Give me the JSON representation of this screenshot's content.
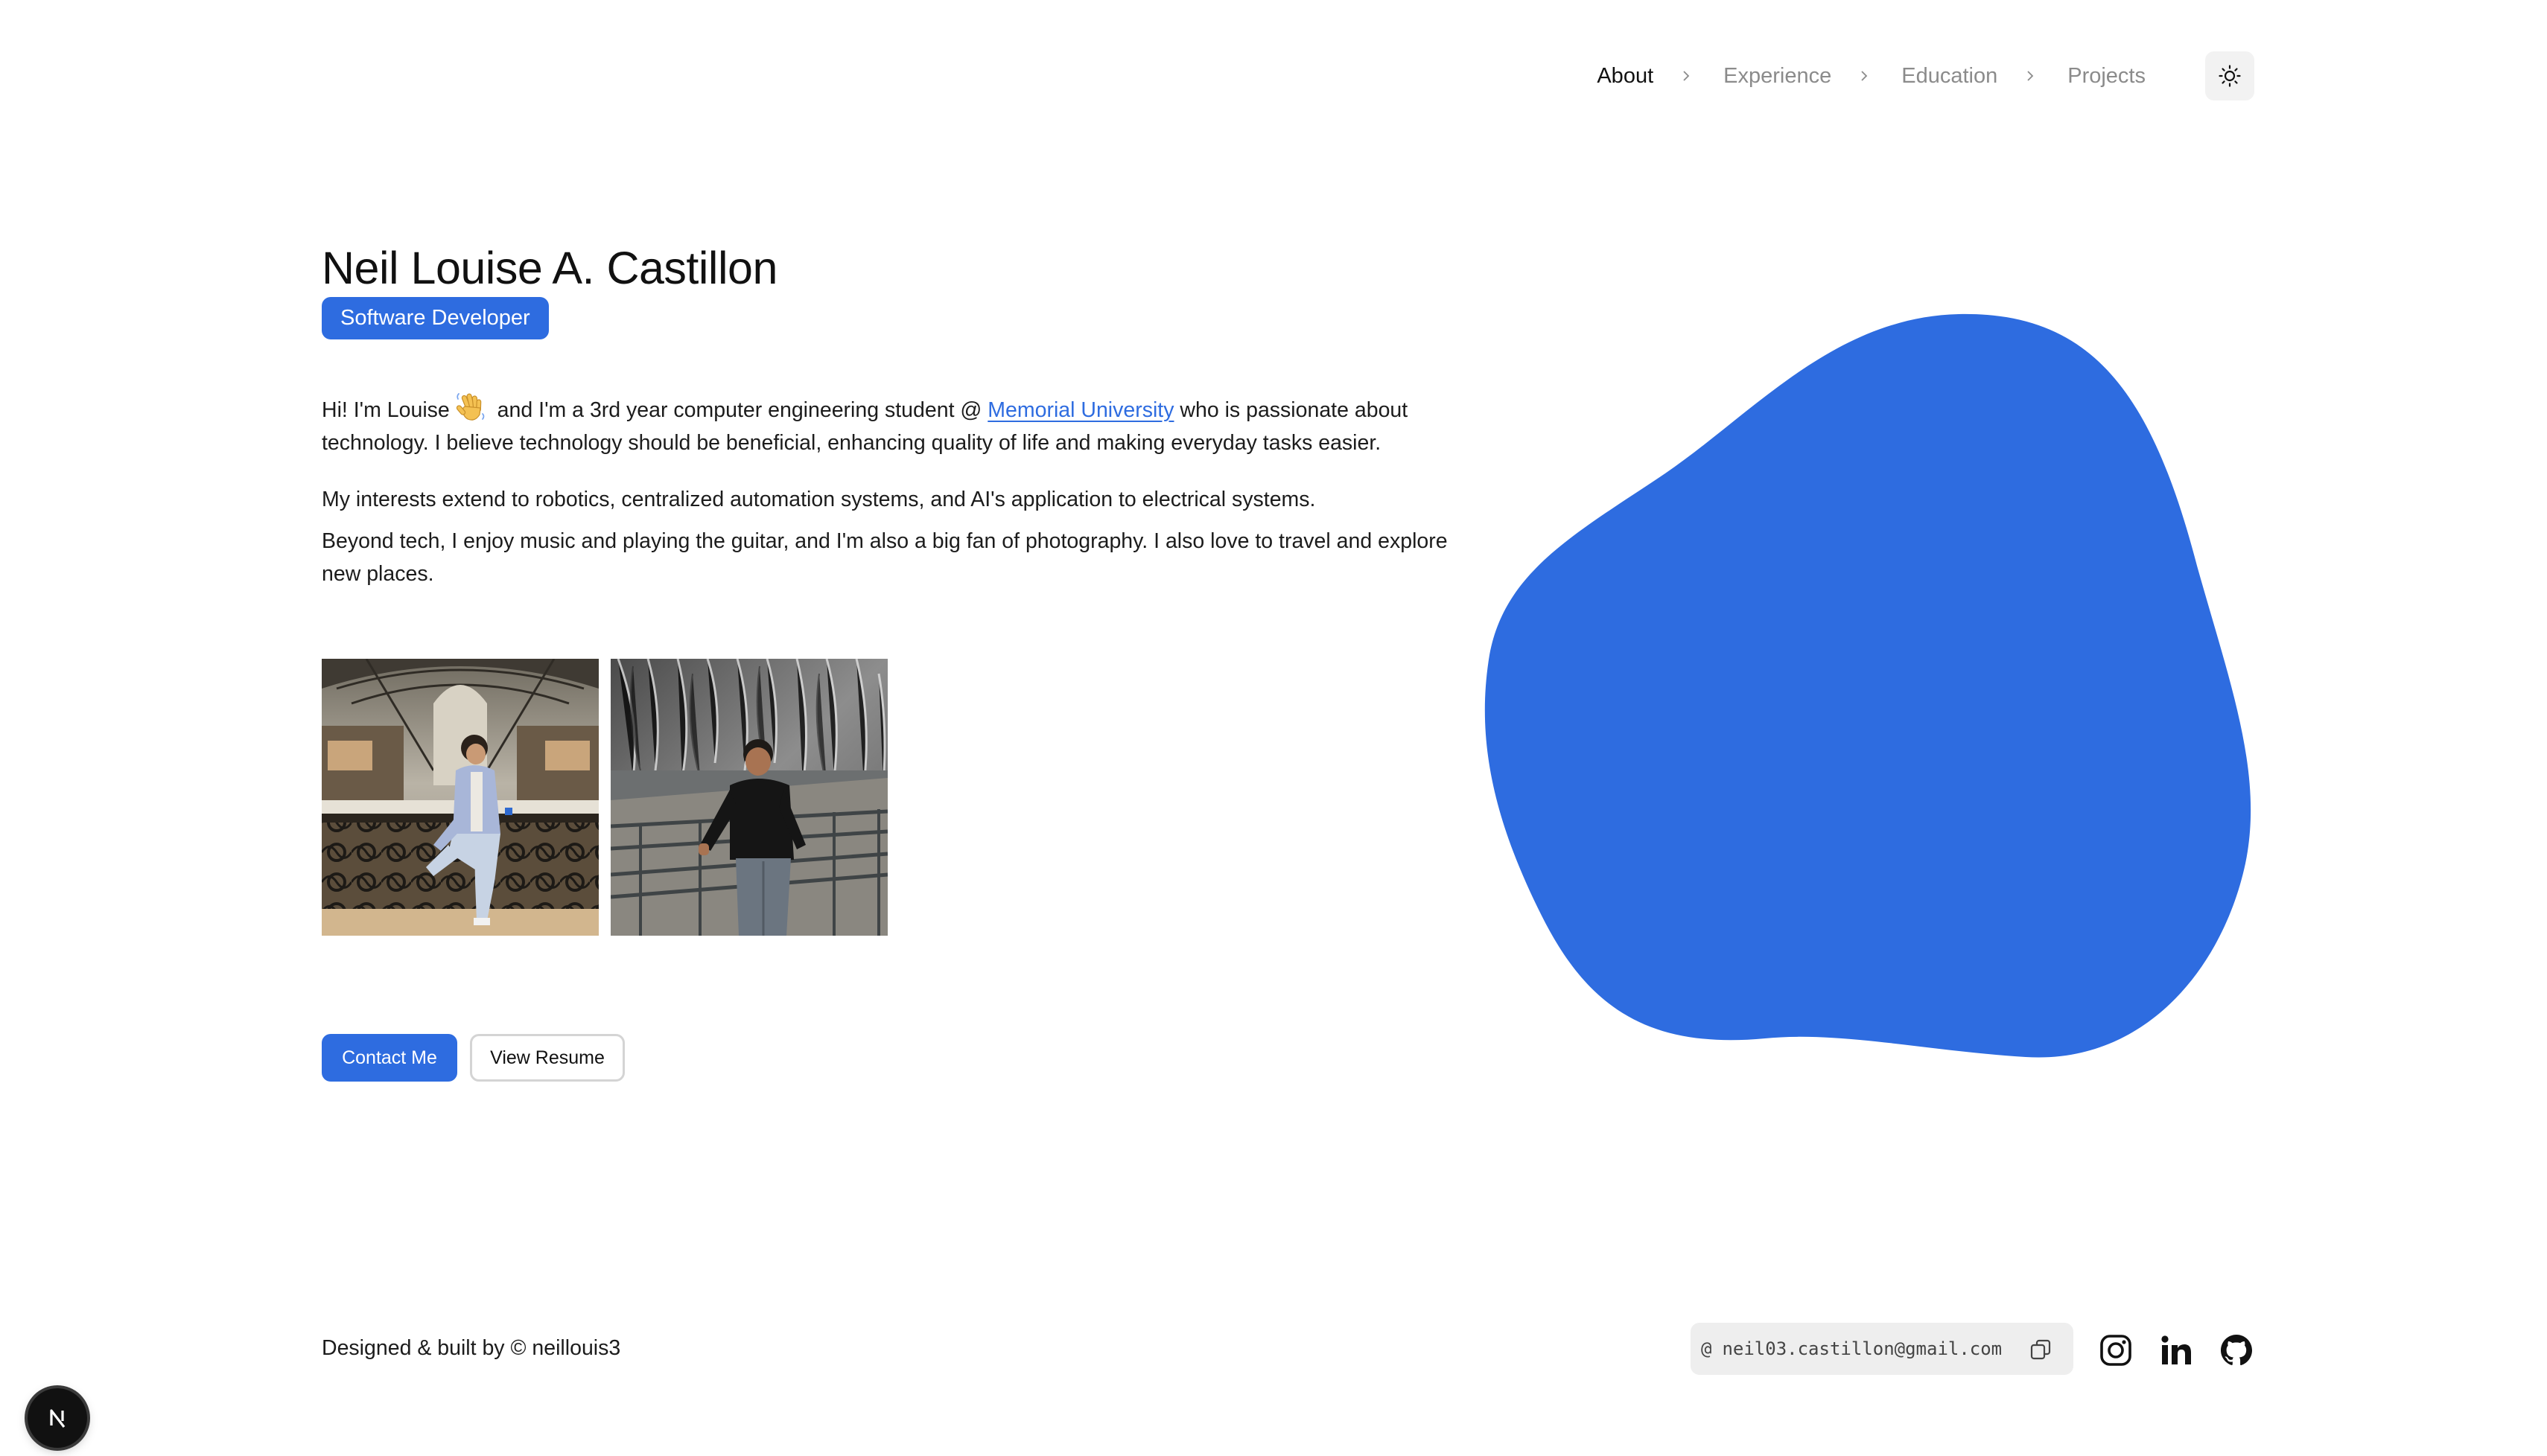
{
  "nav": {
    "items": [
      {
        "label": "About",
        "active": true
      },
      {
        "label": "Experience",
        "active": false
      },
      {
        "label": "Education",
        "active": false
      },
      {
        "label": "Projects",
        "active": false
      }
    ],
    "theme_icon": "sun-icon"
  },
  "hero": {
    "name": "Neil Louise A. Castillon",
    "role": "Software Developer",
    "bio1_a": "Hi! I'm Louise",
    "bio1_emoji": "waving-hand-icon",
    "bio1_b": " and I'm a 3rd year computer engineering student @ ",
    "bio1_link": "Memorial University",
    "bio1_c": " who is passionate about technology. I believe technology should be beneficial, enhancing quality of life and making everyday tasks easier.",
    "bio2": "My interests extend to robotics, centralized automation systems, and AI's application to electrical systems.",
    "bio3": "Beyond tech, I enjoy music and playing the guitar, and I'm also a big fan of photography. I also love to travel and explore new places."
  },
  "photos": [
    "photo-mall",
    "photo-waterfall"
  ],
  "actions": {
    "contact": "Contact Me",
    "resume": "View Resume"
  },
  "footer": {
    "credit": "Designed & built by © neillouis3",
    "email_at": "@",
    "email": "neil03.castillon@gmail.com",
    "socials": [
      "instagram-icon",
      "linkedin-icon",
      "github-icon"
    ]
  },
  "colors": {
    "accent": "#2e6ce0",
    "text": "#1a1a1a",
    "muted": "#8b8b8b"
  }
}
